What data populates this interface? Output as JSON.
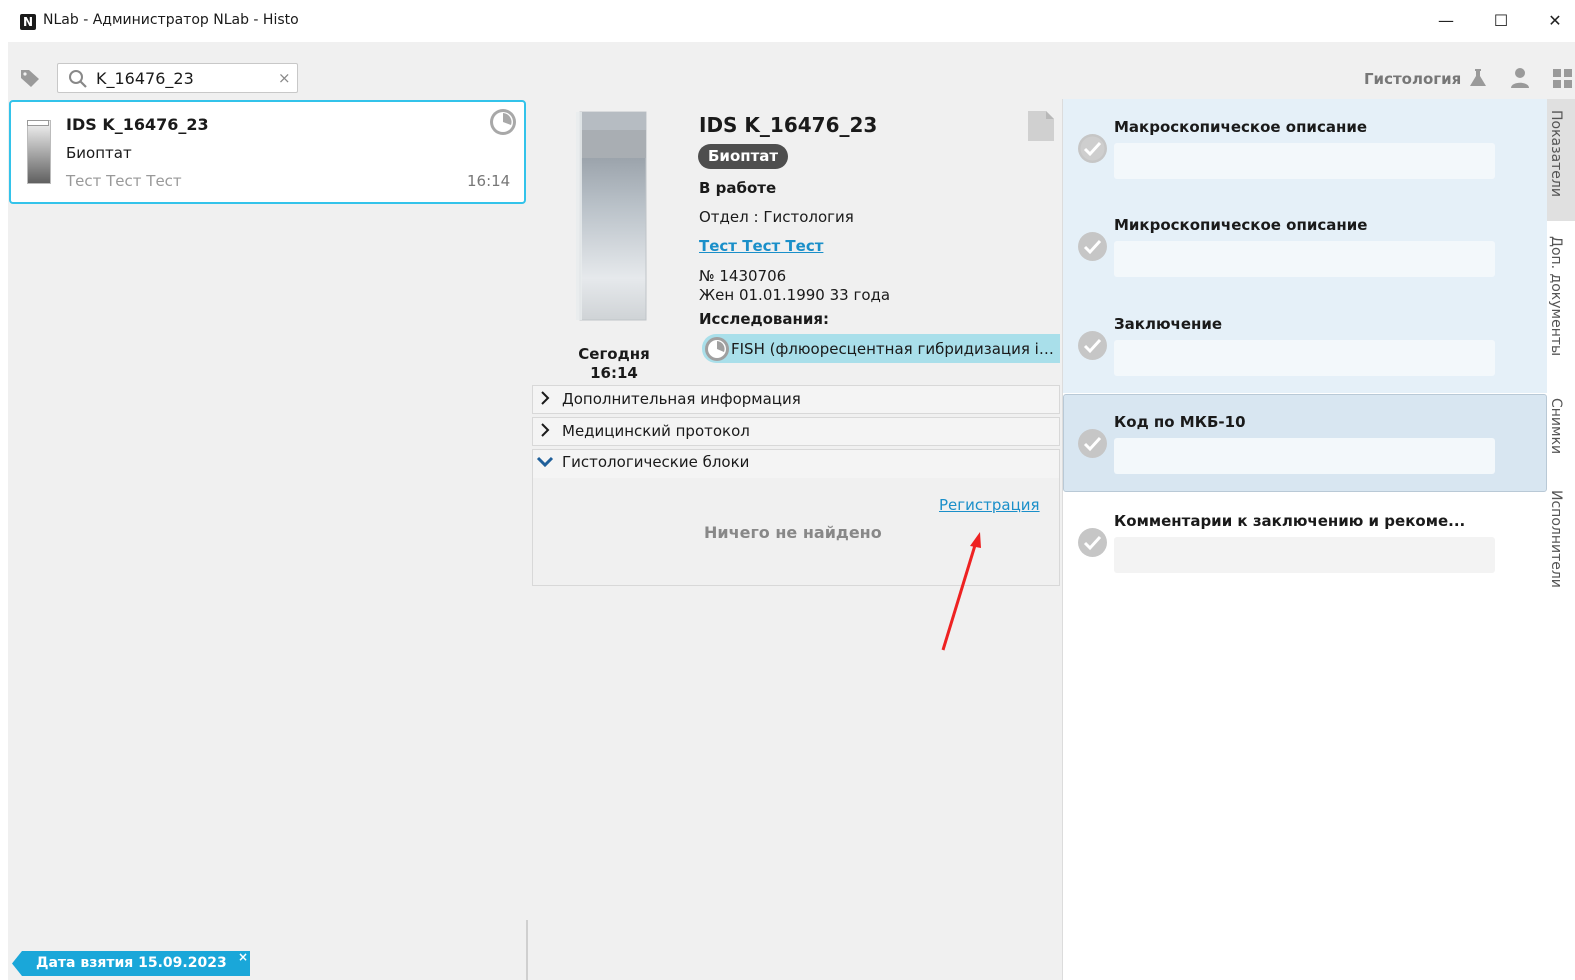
{
  "window": {
    "logo_letter": "N",
    "title": "NLab - Администратор NLab - Histo",
    "minimize": "—",
    "maximize": "☐",
    "close": "✕"
  },
  "toolbar": {
    "search_value": "K_16476_23",
    "clear": "×",
    "department": "Гистология"
  },
  "sample_list": {
    "items": [
      {
        "id": "IDS K_16476_23",
        "type": "Биоптат",
        "patient": "Тест Тест Тест",
        "time": "16:14"
      }
    ],
    "date_filter": "Дата взятия 15.09.2023",
    "date_filter_close": "×"
  },
  "sample": {
    "id": "IDS K_16476_23",
    "type": "Биоптат",
    "status": "В работе",
    "department": "Отдел : Гистология",
    "patient": "Тест Тест Тест",
    "record_number": "№ 1430706",
    "patient_info": "Жен 01.01.1990 33 года",
    "studies_label": "Исследования:",
    "study": "FISH (флюоресцентная гибридизация in situ)",
    "date_label": "Сегодня",
    "time_label": "16:14"
  },
  "sections": {
    "additional_info": "Дополнительная информация",
    "medical_protocol": "Медицинский протокол",
    "histology_blocks": "Гистологические блоки",
    "register_link": "Регистрация",
    "nothing_found": "Ничего не найдено"
  },
  "fields": [
    {
      "title": "Макроскопическое описание",
      "value": ""
    },
    {
      "title": "Микроскопическое описание",
      "value": ""
    },
    {
      "title": "Заключение",
      "value": ""
    },
    {
      "title": "Код по МКБ-10",
      "value": ""
    },
    {
      "title": "Комментарии к заключению и рекоме...",
      "value": ""
    }
  ],
  "side_tabs": [
    "Показатели",
    "Доп. документы",
    "Снимки",
    "Исполнители"
  ],
  "colors": {
    "accent": "#33c3ea",
    "link": "#1a8fc9",
    "tag": "#1aa7d9",
    "field_bg": "#e5f0f8",
    "field_selected": "#d8e6f1",
    "study_chip": "#a9dfea"
  }
}
